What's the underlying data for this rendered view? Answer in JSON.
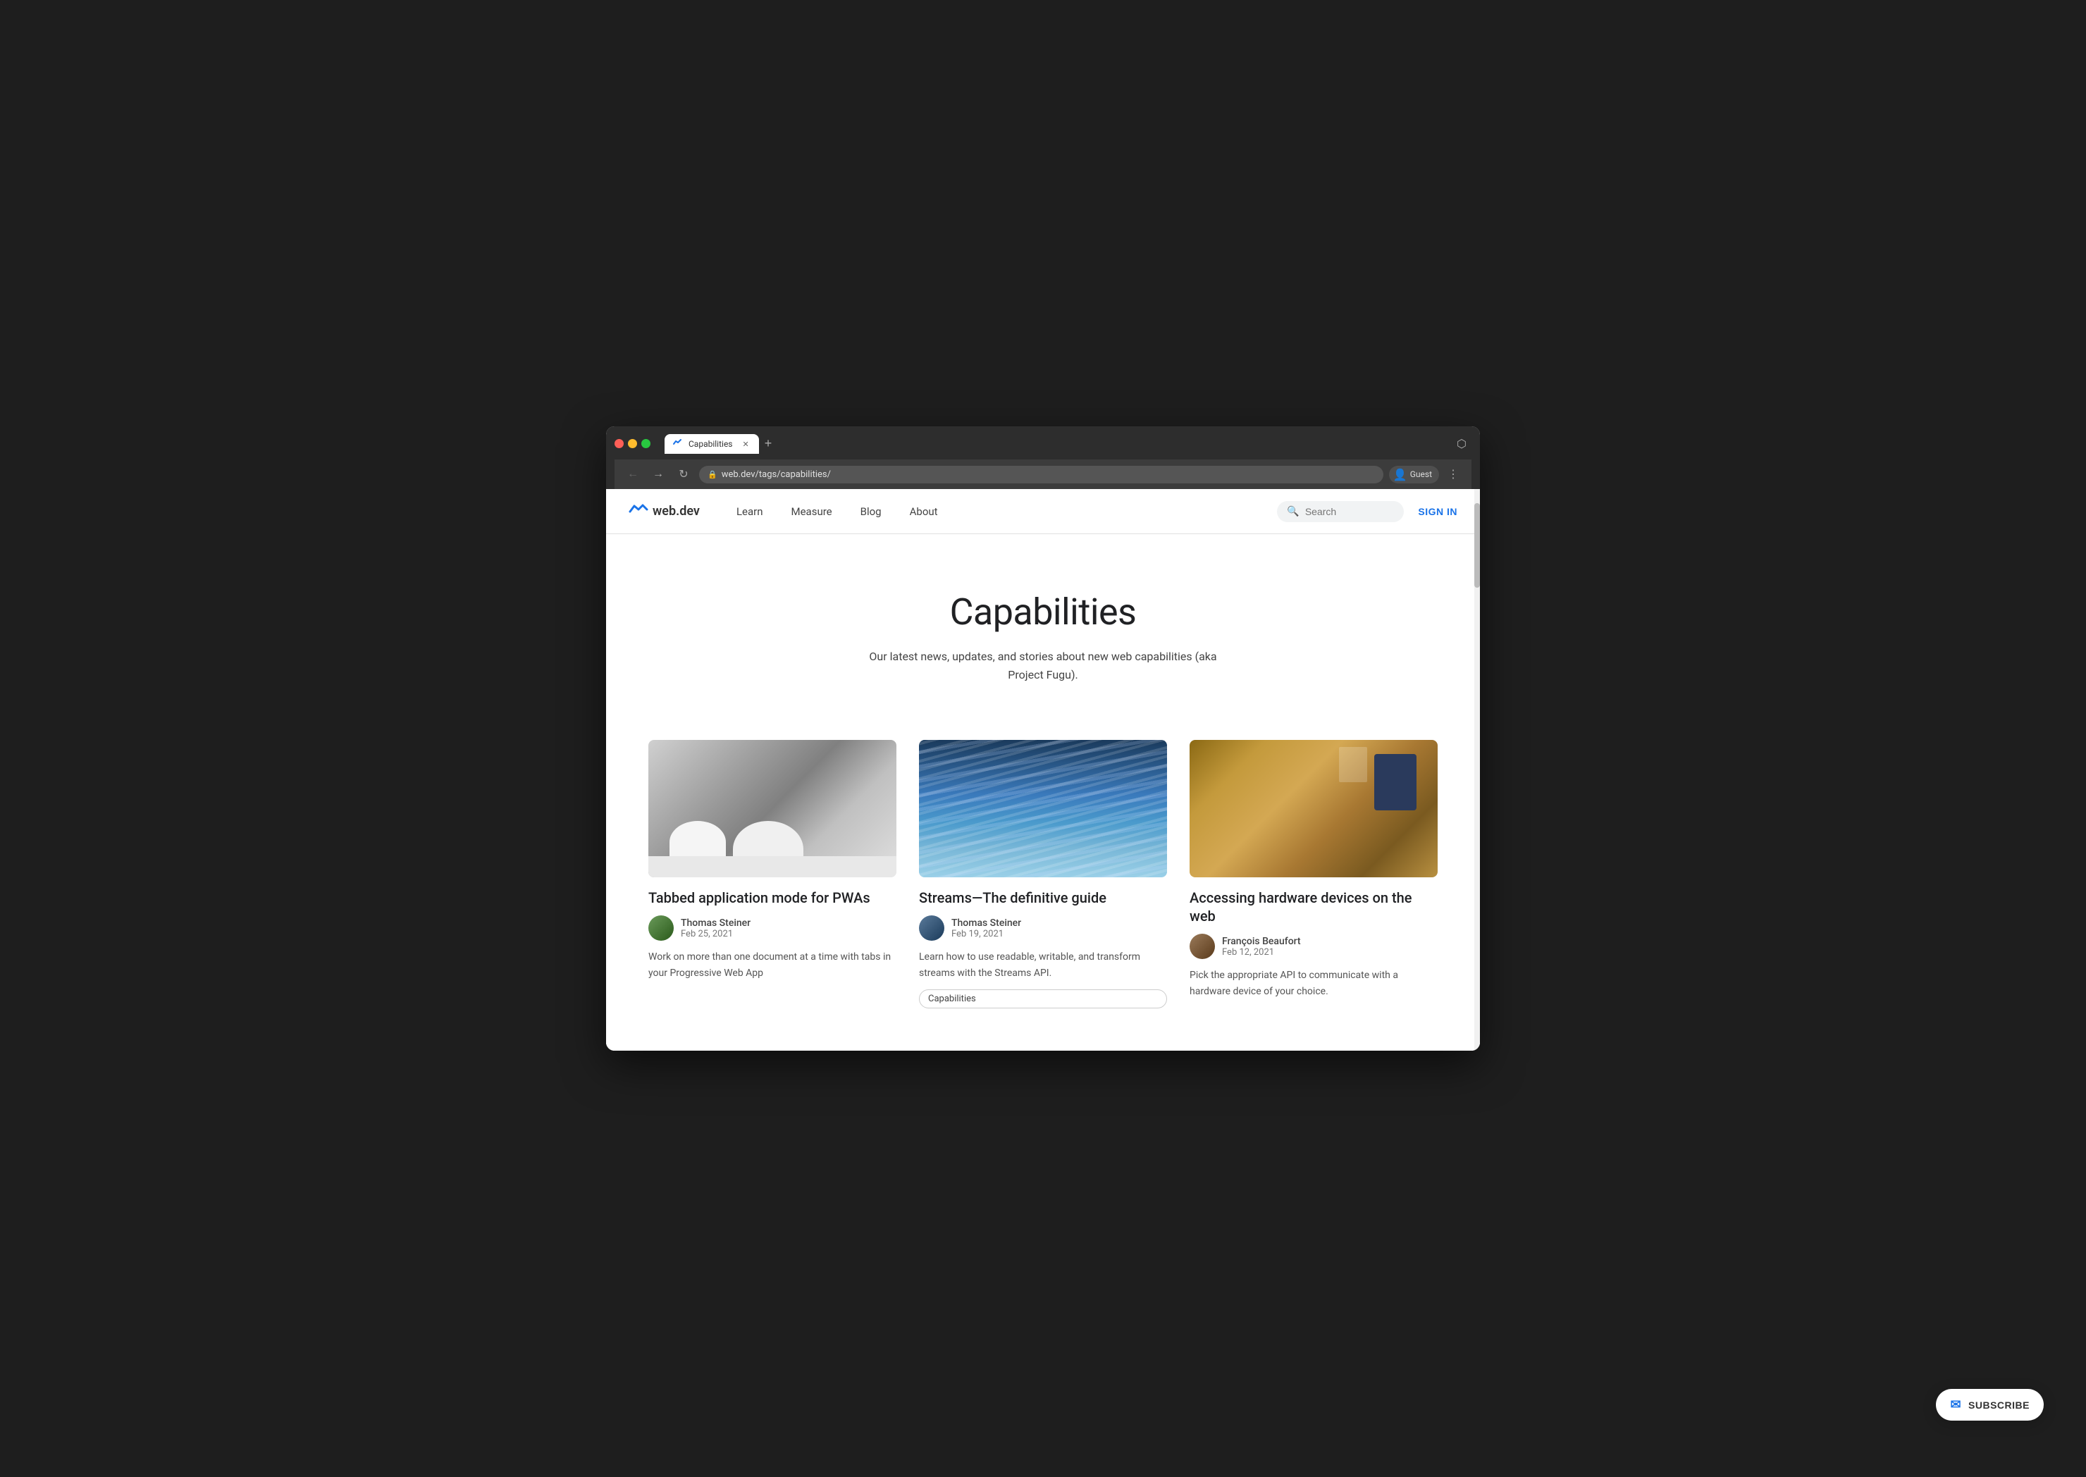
{
  "browser": {
    "tab_title": "Capabilities",
    "tab_new_label": "+",
    "url": "web.dev/tags/capabilities/",
    "nav_back_icon": "←",
    "nav_forward_icon": "→",
    "nav_reload_icon": "↻",
    "nav_extensions_icon": "⬡",
    "nav_user_label": "Guest",
    "nav_menu_icon": "⋮"
  },
  "site": {
    "logo_text": "web.dev",
    "nav_links": [
      {
        "label": "Learn",
        "id": "learn"
      },
      {
        "label": "Measure",
        "id": "measure"
      },
      {
        "label": "Blog",
        "id": "blog"
      },
      {
        "label": "About",
        "id": "about"
      }
    ],
    "search_placeholder": "Search",
    "sign_in_label": "SIGN IN"
  },
  "hero": {
    "title": "Capabilities",
    "description": "Our latest news, updates, and stories about new web capabilities (aka Project Fugu)."
  },
  "articles": [
    {
      "id": "tabbed-pwa",
      "title": "Tabbed application mode for PWAs",
      "author_name": "Thomas Steiner",
      "date": "Feb 25, 2021",
      "excerpt": "Work on more than one document at a time with tabs in your Progressive Web App",
      "tag": null,
      "image_class": "img-tabbed"
    },
    {
      "id": "streams",
      "title": "Streams—The definitive guide",
      "author_name": "Thomas Steiner",
      "date": "Feb 19, 2021",
      "excerpt": "Learn how to use readable, writable, and transform streams with the Streams API.",
      "tag": "Capabilities",
      "image_class": "img-streams"
    },
    {
      "id": "hardware",
      "title": "Accessing hardware devices on the web",
      "author_name": "François Beaufort",
      "date": "Feb 12, 2021",
      "excerpt": "Pick the appropriate API to communicate with a hardware device of your choice.",
      "tag": null,
      "image_class": "img-hardware"
    }
  ],
  "subscribe": {
    "label": "SUBSCRIBE",
    "icon": "✉"
  }
}
